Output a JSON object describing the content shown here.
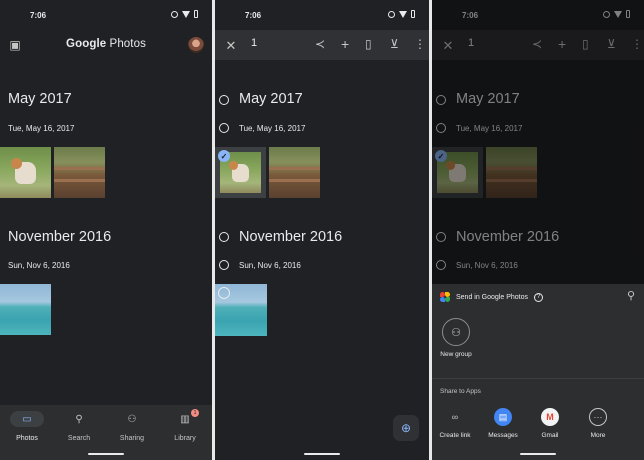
{
  "status": {
    "time": "7:06"
  },
  "panel1": {
    "app_title_prefix": "Google",
    "app_title_suffix": " Photos",
    "sections": [
      {
        "month": "May 2017",
        "day": "Tue, May 16, 2017"
      },
      {
        "month": "November 2016",
        "day": "Sun, Nov 6, 2016"
      }
    ],
    "nav": [
      {
        "label": "Photos",
        "icon": "photo-icon"
      },
      {
        "label": "Search",
        "icon": "search-icon"
      },
      {
        "label": "Sharing",
        "icon": "people-icon"
      },
      {
        "label": "Library",
        "icon": "library-icon",
        "badge": "1"
      }
    ]
  },
  "panel2": {
    "selected_count": "1",
    "sections": [
      {
        "month": "May 2017",
        "day": "Tue, May 16, 2017"
      },
      {
        "month": "November 2016",
        "day": "Sun, Nov 6, 2016"
      }
    ]
  },
  "panel3": {
    "selected_count": "1",
    "sections": [
      {
        "month": "May 2017",
        "day": "Tue, May 16, 2017"
      },
      {
        "month": "November 2016",
        "day": "Sun, Nov 6, 2016"
      }
    ],
    "sheet": {
      "send_title": "Send in Google Photos",
      "new_group_label": "New group",
      "share_title": "Share to Apps",
      "apps": [
        {
          "label": "Create link",
          "icon": "link-icon"
        },
        {
          "label": "Messages",
          "icon": "messages-icon"
        },
        {
          "label": "Gmail",
          "icon": "gmail-icon"
        },
        {
          "label": "More",
          "icon": "more-icon"
        }
      ]
    }
  },
  "colors": {
    "background": "#202124",
    "accent": "#8ab4f8",
    "sheet": "#2d2e30"
  }
}
